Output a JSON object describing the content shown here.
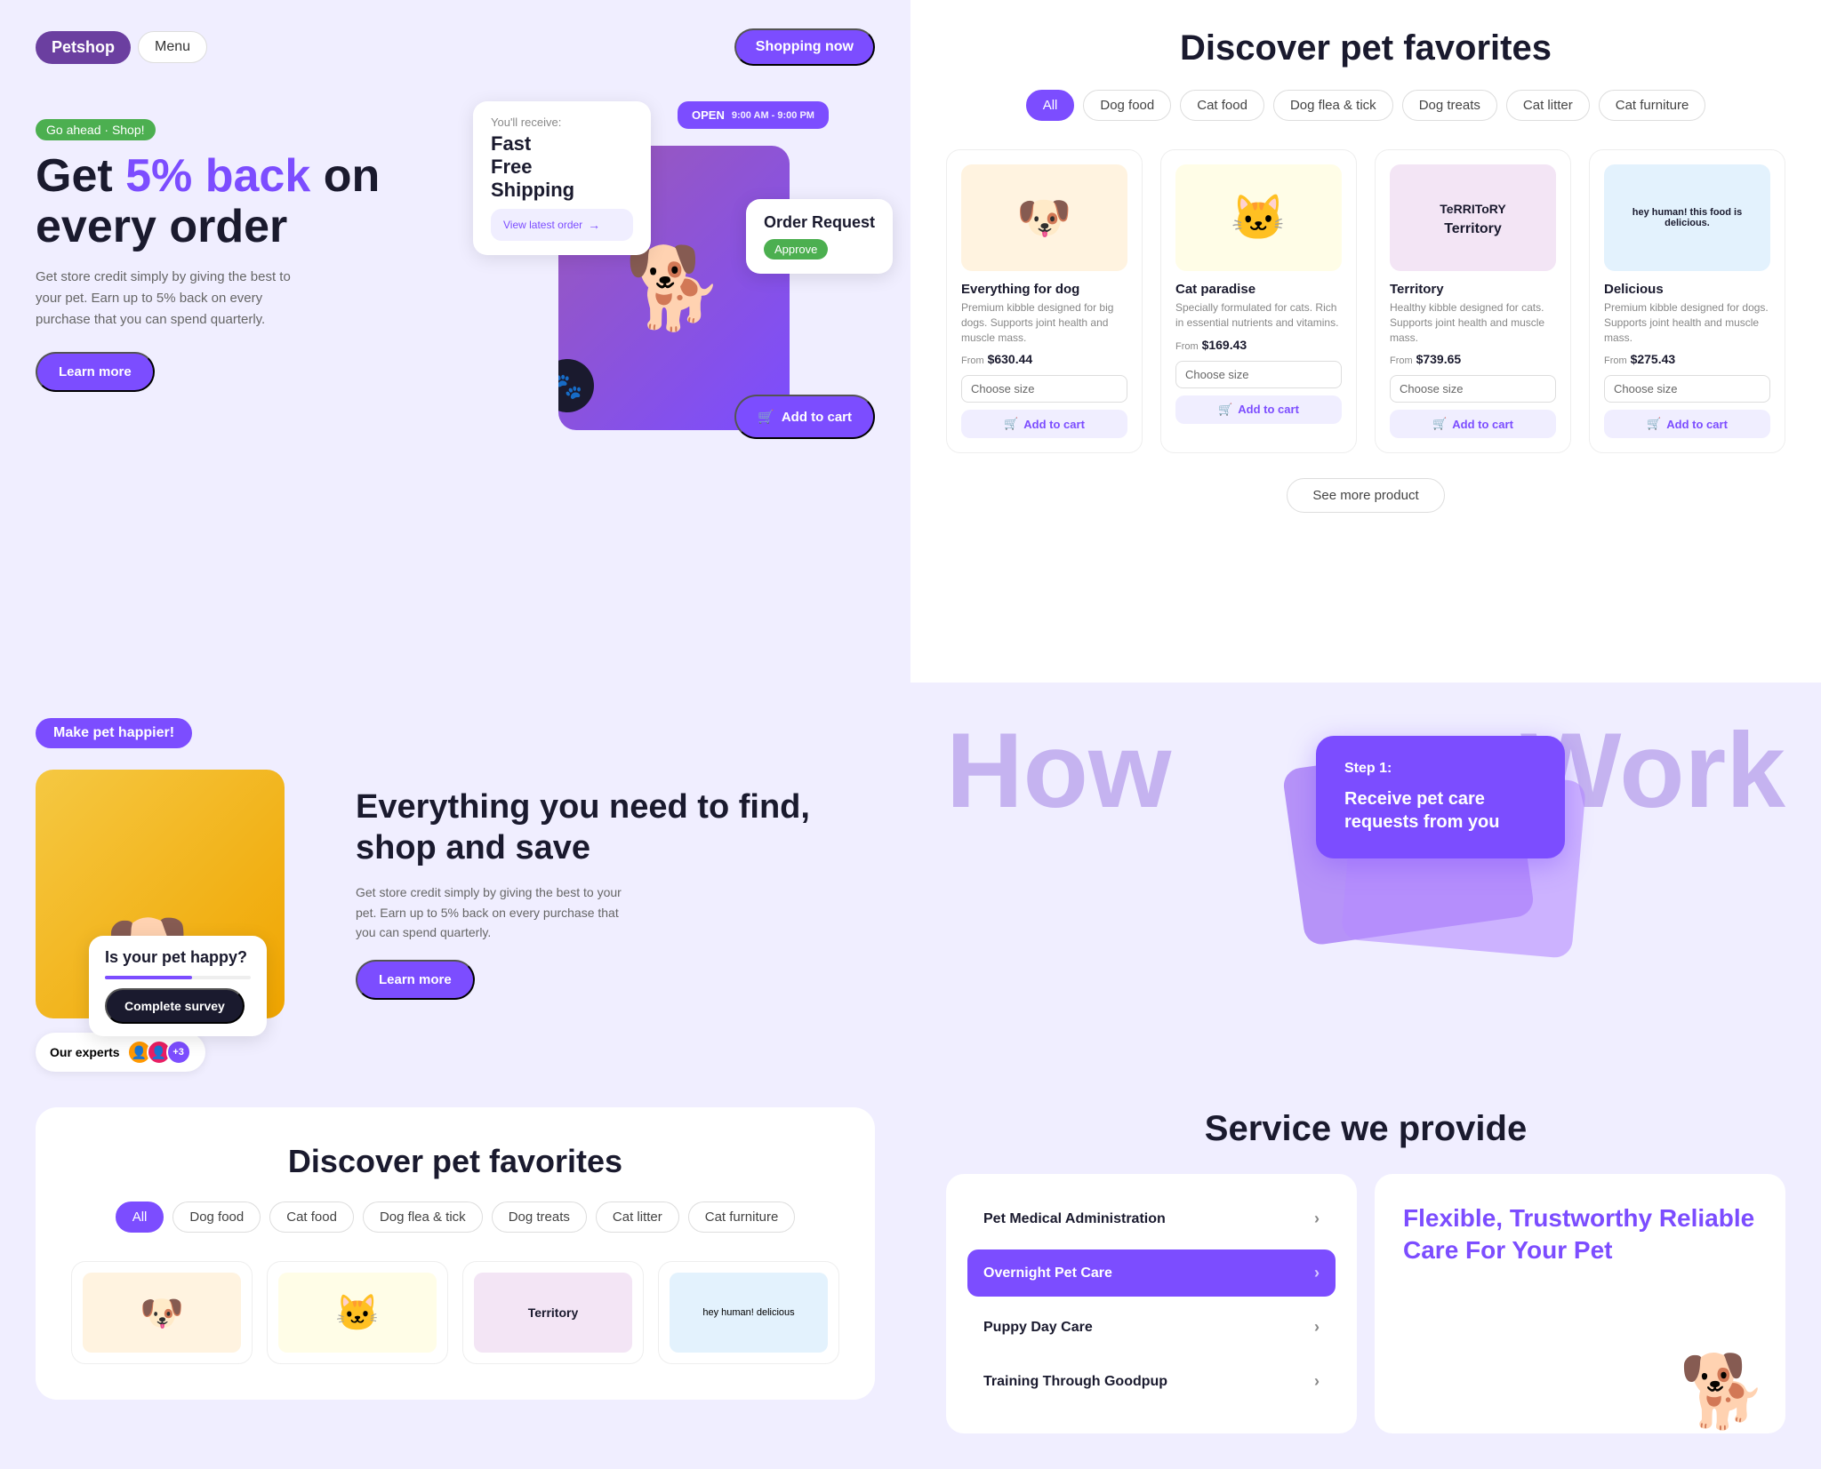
{
  "header": {
    "logo": "Petshop",
    "menu": "Menu",
    "shopping_btn": "Shopping now"
  },
  "hero": {
    "badge": "Go ahead · Shop!",
    "title_prefix": "Get ",
    "highlight": "5% back",
    "title_suffix": " on every order",
    "subtitle": "Get store credit simply by giving the best to your pet. Earn up to 5% back on every purchase that you can spend quarterly.",
    "learn_more": "Learn more",
    "floating": {
      "youll_receive": "You'll receive:",
      "fast": "Fast",
      "free": "Free",
      "shipping": "Shipping",
      "view_latest": "View latest order",
      "open": "OPEN",
      "hours": "9:00 AM - 9:00 PM",
      "order_request": "Order Request",
      "approve": "Approve",
      "add_to_cart": "Add to cart"
    }
  },
  "discover_right": {
    "title": "Discover pet favorites",
    "filters": [
      "All",
      "Dog food",
      "Cat food",
      "Dog flea & tick",
      "Dog treats",
      "Cat litter",
      "Cat furniture"
    ],
    "active_filter": "All",
    "products": [
      {
        "name": "Everything for dog",
        "desc": "Premium kibble designed for big dogs. Supports joint health and muscle mass.",
        "price": "$630.44",
        "from": "From",
        "size_placeholder": "Choose size",
        "add_cart": "Add to cart",
        "img_emoji": "🐶",
        "img_color": "orange"
      },
      {
        "name": "Cat paradise",
        "desc": "Specially formulated for cats. Rich in essential nutrients and vitamins.",
        "price": "$169.43",
        "from": "From",
        "size_placeholder": "Choose size",
        "add_cart": "Add to cart",
        "img_emoji": "🐱",
        "img_color": "yellow"
      },
      {
        "name": "Territory",
        "desc": "Healthy kibble designed for cats. Supports joint health and muscle mass.",
        "price": "$739.65",
        "from": "From",
        "size_placeholder": "Choose size",
        "add_cart": "Add to cart",
        "img_text": "TeRRIToRY Territory",
        "img_color": "purple"
      },
      {
        "name": "Delicious",
        "desc": "Premium kibble designed for dogs. Supports joint health and muscle mass.",
        "price": "$275.43",
        "from": "From",
        "size_placeholder": "Choose size",
        "add_cart": "Add to cart",
        "img_text": "hey human! this food is delicious.",
        "img_color": "blue"
      }
    ],
    "see_more": "See more product"
  },
  "how_it_works": {
    "how": "How",
    "work": "Work",
    "step1": "Step 1:",
    "step1_desc": "Receive pet care requests from you"
  },
  "services": {
    "title": "Service we provide",
    "items": [
      {
        "label": "Pet Medical Administration",
        "active": false
      },
      {
        "label": "Overnight Pet Care",
        "active": true
      },
      {
        "label": "Puppy Day Care",
        "active": false
      },
      {
        "label": "Training Through Goodpup",
        "active": false
      }
    ],
    "promo": {
      "title": "Flexible, Trustworthy Reliable Care For Your Pet"
    }
  },
  "bottom_left": {
    "make_pet_badge": "Make pet happier!",
    "survey_q": "Is your pet happy?",
    "complete_survey": "Complete survey",
    "experts_label": "Our experts",
    "expert_count": "+3",
    "everything_title": "Everything you need to find, shop and save",
    "everything_sub": "Get store credit simply by giving the best to your pet. Earn up to 5% back on every purchase that you can spend quarterly.",
    "learn_more": "Learn more"
  },
  "discover_bottom": {
    "title": "Discover pet favorites",
    "filters": [
      "All",
      "Dog food",
      "Cat food",
      "Dog flea & tick",
      "Dog treats",
      "Cat litter",
      "Cat furniture"
    ],
    "active_filter": "All",
    "products": [
      {
        "img_emoji": "🐶",
        "img_color": "orange"
      },
      {
        "img_emoji": "🐱",
        "img_color": "yellow"
      },
      {
        "img_text": "TERRITORY",
        "img_color": "purple"
      },
      {
        "img_text": "delicious",
        "img_color": "blue"
      }
    ]
  }
}
